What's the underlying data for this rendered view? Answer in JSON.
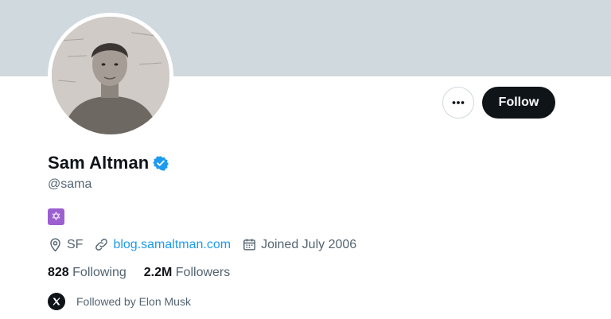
{
  "profile": {
    "name": "Sam Altman",
    "handle": "@sama",
    "verified_icon": "verified-badge-icon",
    "bio_emoji": "✡",
    "location": "SF",
    "website": "blog.samaltman.com",
    "joined": "Joined July 2006"
  },
  "actions": {
    "follow_label": "Follow",
    "more_icon": "more-dots-icon"
  },
  "stats": {
    "following_count": "828",
    "following_label": "Following",
    "followers_count": "2.2M",
    "followers_label": "Followers"
  },
  "followed_by": {
    "text": "Followed by Elon Musk"
  },
  "colors": {
    "banner": "#cfd9de",
    "accent": "#1d9bf0",
    "follow_button": "#0f1419",
    "secondary_text": "#536471",
    "bio_emoji_bg": "#9b5fd0"
  }
}
